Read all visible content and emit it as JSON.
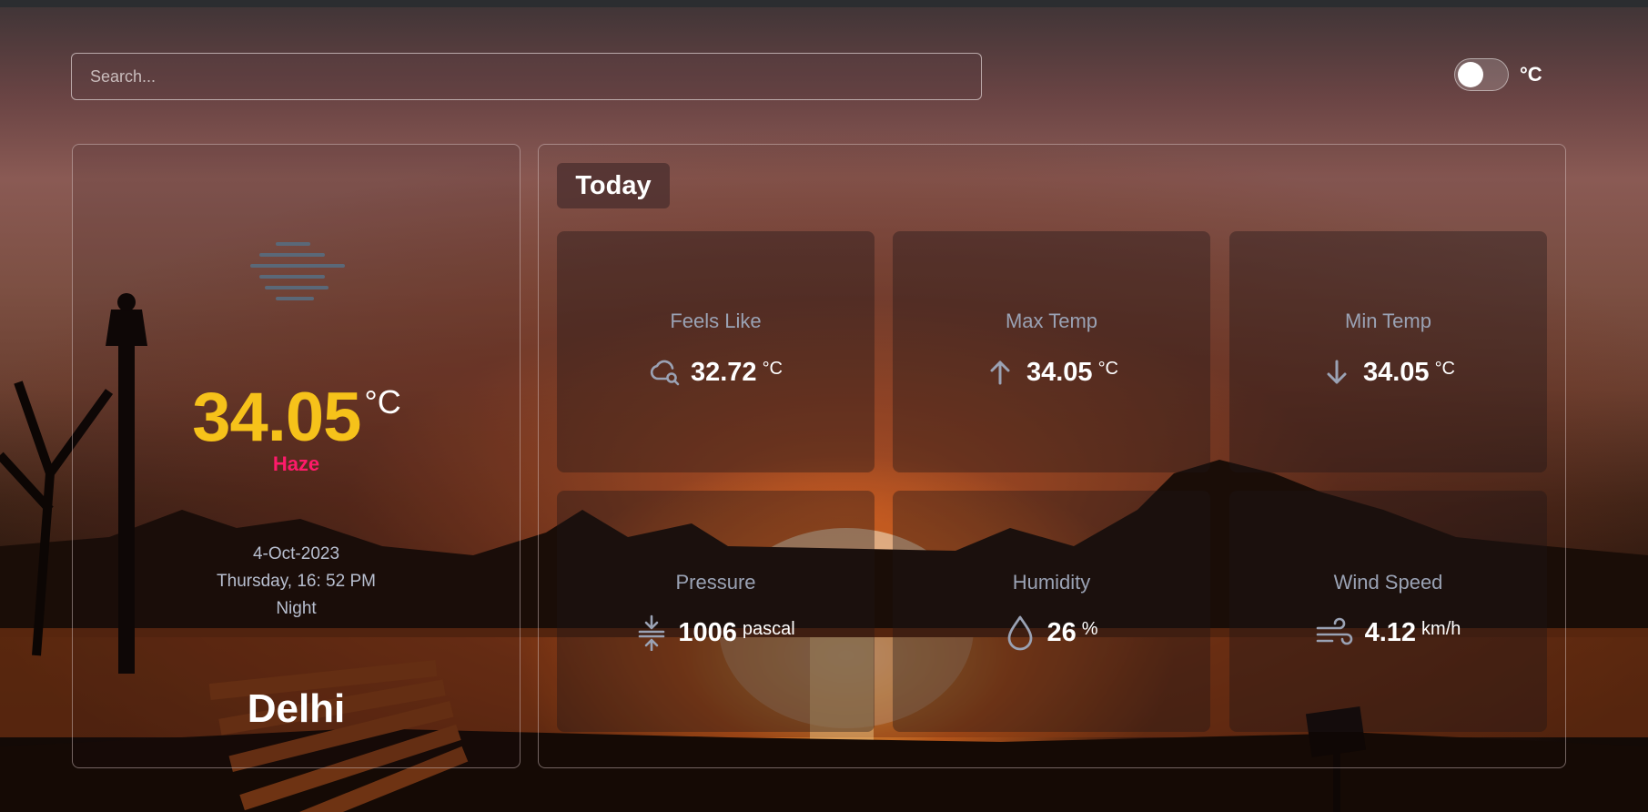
{
  "search": {
    "placeholder": "Search..."
  },
  "unit_toggle": {
    "label": "°C",
    "on": false
  },
  "current": {
    "icon": "haze-icon",
    "temperature": "34.05",
    "unit": "°C",
    "condition": "Haze",
    "date": "4-Oct-2023",
    "day_time": "Thursday, 16: 52 PM",
    "period": "Night",
    "city": "Delhi"
  },
  "today": {
    "heading": "Today",
    "tiles": [
      {
        "title": "Feels Like",
        "icon": "cloud-search-icon",
        "value": "32.72",
        "unit": "°C"
      },
      {
        "title": "Max Temp",
        "icon": "arrow-up-icon",
        "value": "34.05",
        "unit": "°C"
      },
      {
        "title": "Min Temp",
        "icon": "arrow-down-icon",
        "value": "34.05",
        "unit": "°C"
      },
      {
        "title": "Pressure",
        "icon": "compress-icon",
        "value": "1006",
        "unit": "pascal"
      },
      {
        "title": "Humidity",
        "icon": "droplet-icon",
        "value": "26",
        "unit": "%"
      },
      {
        "title": "Wind Speed",
        "icon": "wind-icon",
        "value": "4.12",
        "unit": "km/h"
      }
    ]
  },
  "colors": {
    "temperature": "#f6c21a",
    "condition": "#ff1a6a",
    "label": "#9aa2b4",
    "icon": "#9aa2b4"
  }
}
